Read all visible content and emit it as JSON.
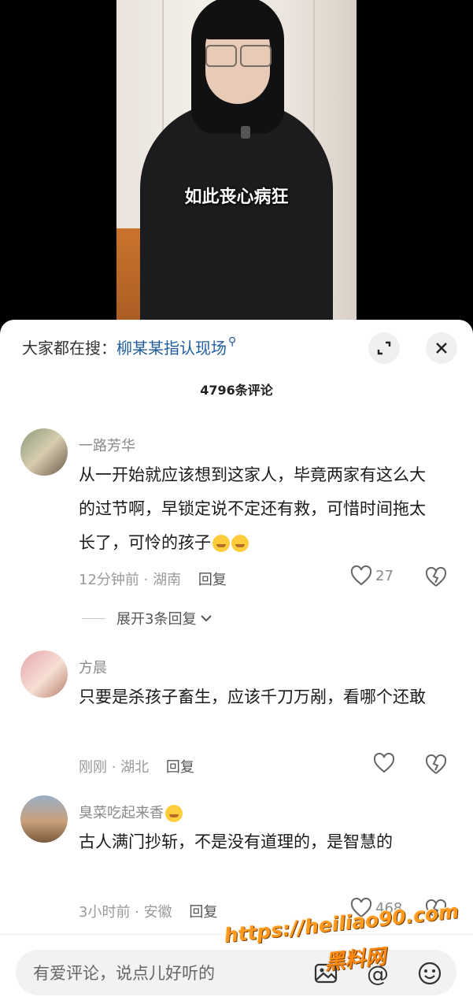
{
  "video": {
    "subtitle": "如此丧心病狂"
  },
  "header": {
    "search_prefix": "大家都在搜：",
    "search_term": "柳某某指认现场",
    "comment_count": "4796条评论",
    "expand_icon": "expand-icon",
    "close_icon": "close-icon"
  },
  "comments": [
    {
      "username": "一路芳华",
      "content": "从一开始就应该想到这家人，毕竟两家有这么大的过节啊，早锁定说不定还有救，可惜时间拖太长了，可怜的孩子",
      "time": "12分钟前",
      "location": "湖南",
      "reply": "回复",
      "likes": "27",
      "expand": "展开3条回复"
    },
    {
      "username": "方晨",
      "content": "只要是杀孩子畜生，应该千刀万剐，看哪个还敢",
      "time": "刚刚",
      "location": "湖北",
      "reply": "回复",
      "likes": ""
    },
    {
      "username": "臭菜吃起来香",
      "content": "古人满门抄斩，不是没有道理的，是智慧的",
      "time": "3小时前",
      "location": "安徽",
      "reply": "回复",
      "likes": "468"
    }
  ],
  "input": {
    "placeholder": "有爱评论，说点儿好听的"
  },
  "watermark": {
    "url": "https://heiliao90.com",
    "name": "黑料网"
  },
  "colors": {
    "link": "#1f5c9e",
    "watermark": "#ff9a1f"
  }
}
